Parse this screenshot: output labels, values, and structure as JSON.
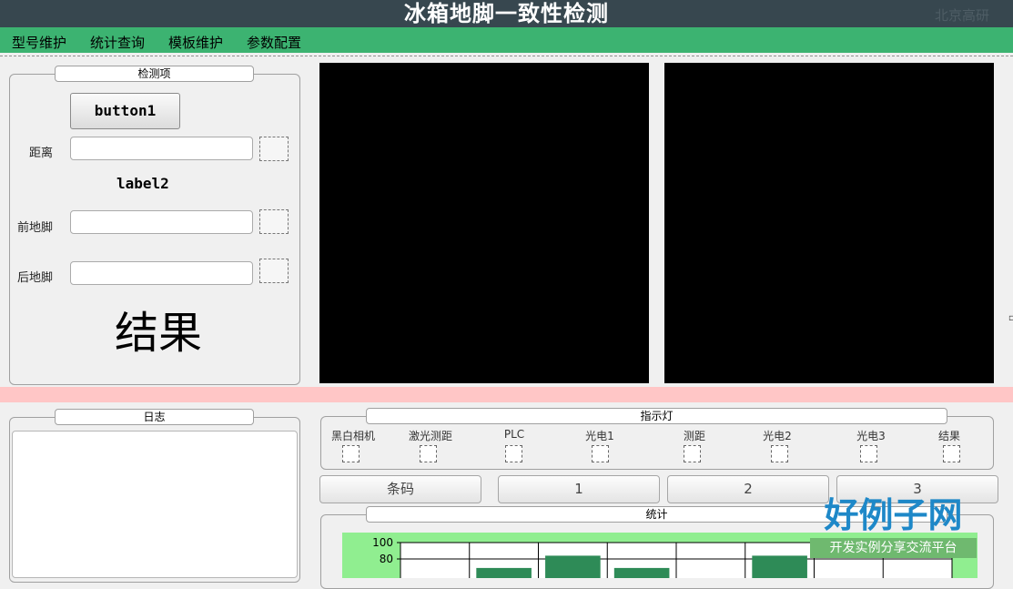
{
  "app": {
    "title": "冰箱地脚一致性检测",
    "title_right": "北京高研"
  },
  "menu": [
    "型号维护",
    "统计查询",
    "模板维护",
    "参数配置"
  ],
  "detection": {
    "group_title": "检测项",
    "button1_label": "button1",
    "distance_label": "距离",
    "distance_value": "",
    "label2_text": "label2",
    "front_foot_label": "前地脚",
    "front_foot_value": "",
    "rear_foot_label": "后地脚",
    "rear_foot_value": "",
    "result_label": "结果"
  },
  "log": {
    "group_title": "日志"
  },
  "indicators": {
    "group_title": "指示灯",
    "items": [
      "黑白相机",
      "激光测距",
      "PLC",
      "光电1",
      "测距",
      "光电2",
      "光电3",
      "结果"
    ]
  },
  "buttons": {
    "barcode": "条码",
    "b1": "1",
    "b2": "2",
    "b3": "3"
  },
  "stats": {
    "group_title": "统计"
  },
  "logo": {
    "main": "好例子网",
    "sub": "开发实例分享交流平台"
  },
  "colors": {
    "titlebar": "#37474f",
    "menubar": "#3cb371",
    "camera_bg": "#000000",
    "divider_strip": "#ffc6c6",
    "chart_bg": "#90ee90",
    "bar_color": "#2e8b57"
  },
  "chart_data": {
    "type": "bar",
    "categories": [
      "",
      "",
      "",
      "",
      "",
      "",
      "",
      ""
    ],
    "values": [
      0,
      69,
      84,
      69,
      0,
      84,
      0,
      0
    ],
    "yticks": [
      80,
      100
    ],
    "ylim": [
      0,
      100
    ],
    "grid": true
  }
}
